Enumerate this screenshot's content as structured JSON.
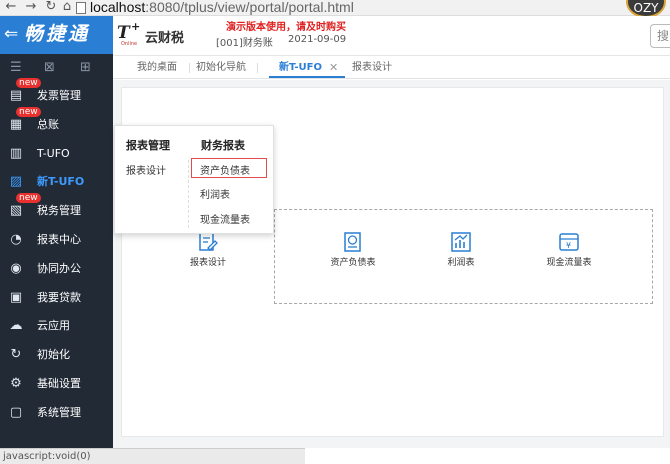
{
  "browser": {
    "url_host": "localhost",
    "url_path": ":8080/tplus/view/portal/portal.html",
    "avatar_text": "OZY"
  },
  "sidebar": {
    "brand_back": "⇐",
    "brand_name": "畅捷通",
    "tool_icons": [
      "menu-icon",
      "grid-edit-icon",
      "add-tile-icon"
    ],
    "items": [
      {
        "label": "发票管理",
        "icon": "invoice-icon",
        "badge": "new"
      },
      {
        "label": "总账",
        "icon": "ledger-icon",
        "badge": "new"
      },
      {
        "label": "T-UFO",
        "icon": "ufo-report-icon",
        "badge": ""
      },
      {
        "label": "新T-UFO",
        "icon": "new-ufo-icon",
        "badge": "",
        "active": true
      },
      {
        "label": "税务管理",
        "icon": "tax-icon",
        "badge": "new"
      },
      {
        "label": "报表中心",
        "icon": "pie-chart-icon",
        "badge": ""
      },
      {
        "label": "协同办公",
        "icon": "collaboration-icon",
        "badge": ""
      },
      {
        "label": "我要贷款",
        "icon": "loan-icon",
        "badge": ""
      },
      {
        "label": "云应用",
        "icon": "cloud-icon",
        "badge": ""
      },
      {
        "label": "初始化",
        "icon": "init-icon",
        "badge": ""
      },
      {
        "label": "基础设置",
        "icon": "settings-icon",
        "badge": ""
      },
      {
        "label": "系统管理",
        "icon": "system-icon",
        "badge": ""
      }
    ]
  },
  "header": {
    "logo_text": "云财税",
    "demo_notice": "演示版本使用，请及时购买",
    "account": "[001]财务账",
    "date": "2021-09-09",
    "search_text": "搜"
  },
  "tabs": [
    {
      "label": "我的桌面",
      "active": false
    },
    {
      "label": "初始化导航",
      "active": false
    },
    {
      "label": "新T-UFO",
      "active": true,
      "closable": true
    },
    {
      "label": "报表设计",
      "active": false
    }
  ],
  "menu": {
    "col1_title": "报表管理",
    "col1_items": [
      "报表设计"
    ],
    "col2_title": "财务报表",
    "col2_items": [
      "资产负债表",
      "利润表",
      "现金流量表"
    ],
    "highlighted_item": "资产负债表"
  },
  "tiles": [
    {
      "label": "报表设计",
      "icon": "report-design-icon"
    },
    {
      "label": "资产负债表",
      "icon": "balance-sheet-icon"
    },
    {
      "label": "利润表",
      "icon": "profit-chart-icon"
    },
    {
      "label": "现金流量表",
      "icon": "cash-flow-icon"
    }
  ],
  "status_bar": "javascript:void(0)",
  "colors": {
    "sidebar_bg": "#222a36",
    "brand_bg": "#2a7fd4",
    "accent": "#2a7fd4",
    "active_nav": "#3d9bff",
    "badge": "#e8312f",
    "notice": "#e02020"
  }
}
